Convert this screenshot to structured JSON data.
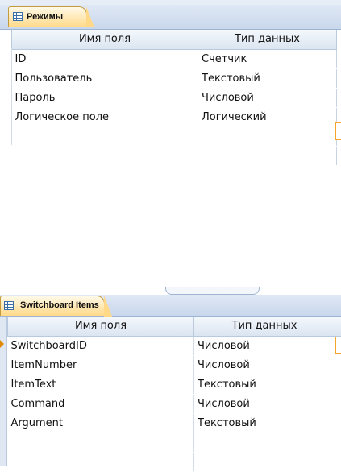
{
  "table1": {
    "tab_label": "Режимы",
    "columns": [
      "Имя поля",
      "Тип данных"
    ],
    "rows": [
      [
        "ID",
        "Счетчик"
      ],
      [
        "Пользователь",
        "Текстовый"
      ],
      [
        "Пароль",
        "Числовой"
      ],
      [
        "Логическое поле",
        "Логический"
      ]
    ]
  },
  "table2": {
    "tab_label": "Switchboard Items",
    "columns": [
      "Имя поля",
      "Тип данных"
    ],
    "rows": [
      [
        "SwitchboardID",
        "Числовой"
      ],
      [
        "ItemNumber",
        "Числовой"
      ],
      [
        "ItemText",
        "Текстовый"
      ],
      [
        "Command",
        "Числовой"
      ],
      [
        "Argument",
        "Текстовый"
      ]
    ]
  },
  "icons": {
    "tab_icon": "table-icon",
    "row_selector": "row-selector-arrow-icon"
  },
  "colors": {
    "tab_fill": "#ffd987",
    "header_fill": "#dbe5f1",
    "focus_border": "#f5a52c"
  }
}
